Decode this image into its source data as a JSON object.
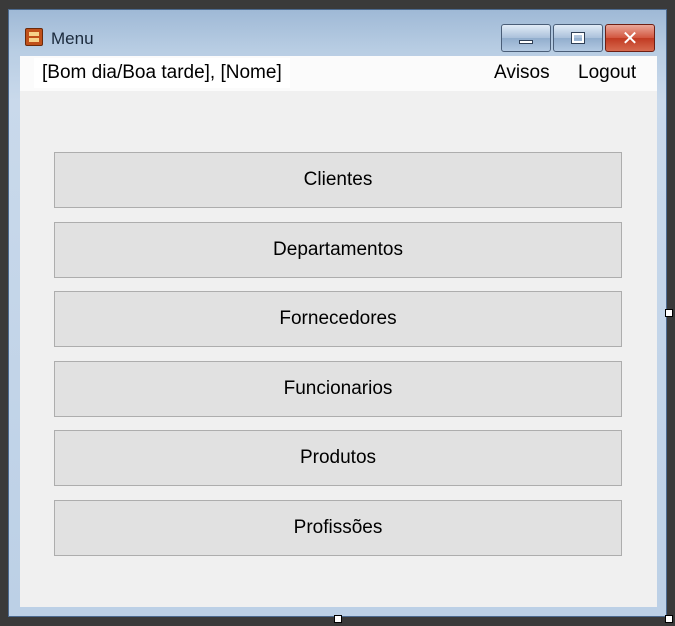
{
  "window": {
    "title": "Menu"
  },
  "title_buttons": {
    "minimize_icon": "minimize-icon",
    "maximize_icon": "maximize-icon",
    "close_icon": "close-icon",
    "close_glyph": "✕"
  },
  "menubar": {
    "greeting": "[Bom dia/Boa tarde], [Nome]",
    "avisos": "Avisos",
    "logout": "Logout"
  },
  "buttons": [
    {
      "label": "Clientes"
    },
    {
      "label": "Departamentos"
    },
    {
      "label": "Fornecedores"
    },
    {
      "label": "Funcionarios"
    },
    {
      "label": "Produtos"
    },
    {
      "label": "Profissões"
    }
  ],
  "colors": {
    "title_text": "#1b2a3c",
    "client_background": "#f0f0f0",
    "button_background": "#e1e1e1",
    "close_button": "#c13a22"
  }
}
